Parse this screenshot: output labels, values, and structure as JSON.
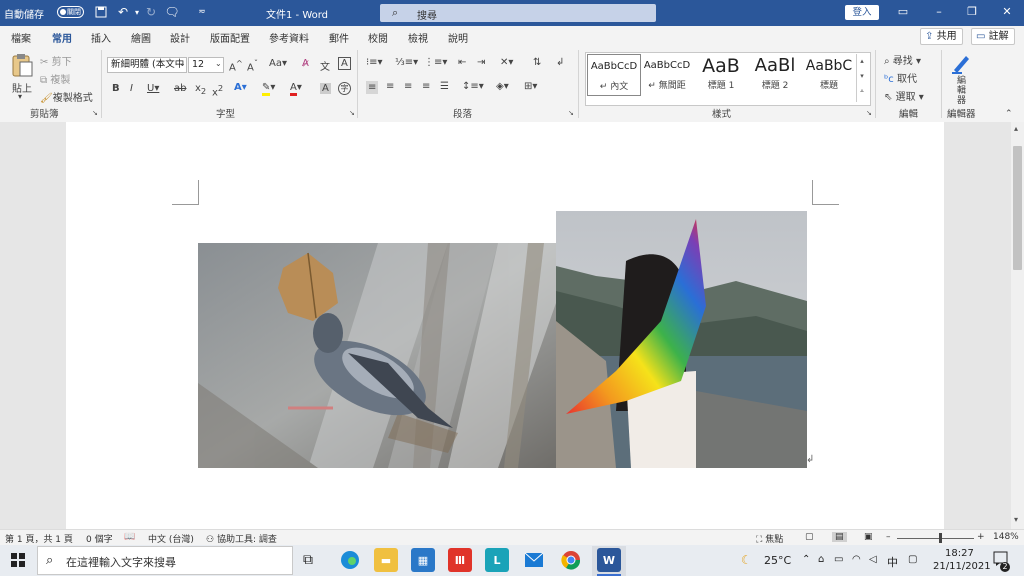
{
  "titlebar": {
    "autosave": "自動儲存",
    "autosave_state": "關閉",
    "doc_title": "文件1 - Word",
    "search_placeholder": "搜尋",
    "signin": "登入",
    "bg": "#2b579a"
  },
  "tabs": [
    "檔案",
    "常用",
    "插入",
    "繪圖",
    "設計",
    "版面配置",
    "參考資料",
    "郵件",
    "校閱",
    "檢視",
    "說明"
  ],
  "active_tab": "常用",
  "share_label": "共用",
  "comments_label": "註解",
  "ribbon": {
    "clipboard": {
      "paste": "貼上",
      "cut": "剪下",
      "copy": "複製",
      "format_painter": "複製格式",
      "group": "剪貼簿"
    },
    "font": {
      "name": "新細明體 (本文中",
      "size": "12",
      "case": "Aa",
      "group": "字型"
    },
    "paragraph": {
      "group": "段落"
    },
    "styles": {
      "items": [
        {
          "sample": "AaBbCcD",
          "name": "↵ 內文"
        },
        {
          "sample": "AaBbCcD",
          "name": "↵ 無間距"
        },
        {
          "sample": "AaB",
          "name": "標題 1"
        },
        {
          "sample": "AaBl",
          "name": "標題 2"
        },
        {
          "sample": "AaBbC",
          "name": "標題"
        }
      ],
      "group": "樣式"
    },
    "editing": {
      "find": "尋找",
      "replace": "取代",
      "select": "選取",
      "group": "編輯"
    },
    "editor": {
      "label": "編\n輯\n器",
      "group": "編輯器"
    }
  },
  "statusbar": {
    "page": "第 1 頁，共 1 頁",
    "words": "0 個字",
    "language": "中文 (台灣)",
    "accessibility": "協助工具: 調查",
    "focus": "焦點",
    "zoom": "148%"
  },
  "taskbar": {
    "search_placeholder": "在這裡輸入文字來搜尋",
    "weather": "25°C",
    "ime": "中",
    "time": "18:27",
    "date": "21/11/2021",
    "notifications": "2"
  }
}
